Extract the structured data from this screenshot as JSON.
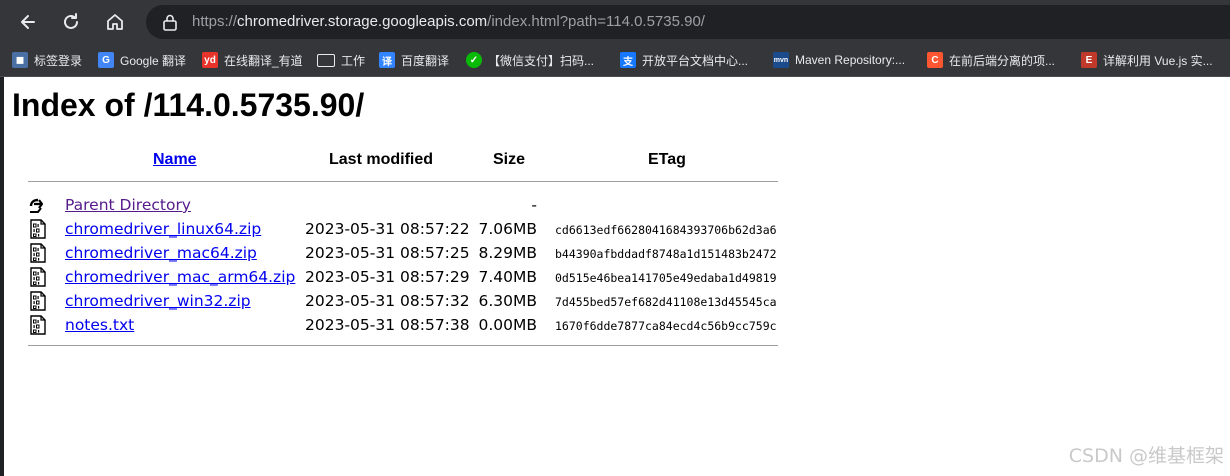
{
  "browser": {
    "url_prefix": "https://",
    "url_host": "chromedriver.storage.googleapis.com",
    "url_path": "/index.html?path=114.0.5735.90/",
    "bookmarks": [
      {
        "label": "标签登录",
        "icon": "user-icon",
        "color": "#4a6fa5"
      },
      {
        "label": "Google 翻译",
        "icon": "google-translate-icon",
        "color": "#4285f4"
      },
      {
        "label": "在线翻译_有道",
        "icon": "youdao-icon",
        "color": "#e8332a"
      },
      {
        "label": "工作",
        "icon": "folder-icon",
        "color": "#35363a"
      },
      {
        "label": "百度翻译",
        "icon": "baidu-translate-icon",
        "color": "#3385ff"
      },
      {
        "label": "【微信支付】扫码...",
        "icon": "wechat-pay-icon",
        "color": "#09bb07"
      },
      {
        "label": "开放平台文档中心...",
        "icon": "alipay-icon",
        "color": "#1677ff"
      },
      {
        "label": "Maven Repository:...",
        "icon": "maven-icon",
        "color": "#1b4b8a"
      },
      {
        "label": "在前后端分离的项...",
        "icon": "csdn-icon",
        "color": "#fc5531"
      },
      {
        "label": "详解利用 Vue.js 实...",
        "icon": "article-icon",
        "color": "#c0392b"
      }
    ]
  },
  "page": {
    "title": "Index of /114.0.5735.90/",
    "columns": {
      "name": "Name",
      "last_modified": "Last modified",
      "size": "Size",
      "etag": "ETag"
    },
    "parent": {
      "name": "Parent Directory",
      "size": "-"
    },
    "files": [
      {
        "name": "chromedriver_linux64.zip",
        "modified": "2023-05-31 08:57:22",
        "size": "7.06MB",
        "etag": "cd6613edf6628041684393706b62d3a6"
      },
      {
        "name": "chromedriver_mac64.zip",
        "modified": "2023-05-31 08:57:25",
        "size": "8.29MB",
        "etag": "b44390afbddadf8748a1d151483b2472"
      },
      {
        "name": "chromedriver_mac_arm64.zip",
        "modified": "2023-05-31 08:57:29",
        "size": "7.40MB",
        "etag": "0d515e46bea141705e49edaba1d49819"
      },
      {
        "name": "chromedriver_win32.zip",
        "modified": "2023-05-31 08:57:32",
        "size": "6.30MB",
        "etag": "7d455bed57ef682d41108e13d45545ca"
      },
      {
        "name": "notes.txt",
        "modified": "2023-05-31 08:57:38",
        "size": "0.00MB",
        "etag": "1670f6dde7877ca84ecd4c56b9cc759c"
      }
    ],
    "watermark": "CSDN @维基框架"
  }
}
